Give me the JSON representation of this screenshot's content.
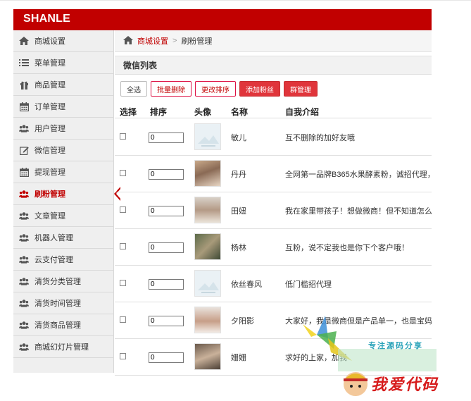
{
  "app": {
    "brand": "SHANLE",
    "colors": {
      "brand_red": "#c10000",
      "button_red": "#e0353b"
    }
  },
  "sidebar": {
    "items": [
      {
        "label": "商城设置",
        "icon": "home-icon"
      },
      {
        "label": "菜单管理",
        "icon": "list-icon"
      },
      {
        "label": "商品管理",
        "icon": "gift-icon"
      },
      {
        "label": "订单管理",
        "icon": "calendar-icon"
      },
      {
        "label": "用户管理",
        "icon": "users-icon"
      },
      {
        "label": "微信管理",
        "icon": "edit-icon"
      },
      {
        "label": "提现管理",
        "icon": "calendar-icon"
      },
      {
        "label": "刷粉管理",
        "icon": "users-icon",
        "active": true
      },
      {
        "label": "文章管理",
        "icon": "users-icon"
      },
      {
        "label": "机器人管理",
        "icon": "users-icon"
      },
      {
        "label": "云支付管理",
        "icon": "users-icon"
      },
      {
        "label": "清货分类管理",
        "icon": "users-icon"
      },
      {
        "label": "清货时间管理",
        "icon": "users-icon"
      },
      {
        "label": "清货商品管理",
        "icon": "users-icon"
      },
      {
        "label": "商城幻灯片管理",
        "icon": "users-icon"
      }
    ]
  },
  "breadcrumb": {
    "parent": "商城设置",
    "separator": ">",
    "current": "刷粉管理"
  },
  "panel": {
    "title": "微信列表"
  },
  "toolbar": {
    "select_all": "全选",
    "batch_delete": "批量删除",
    "change_order": "更改排序",
    "add_fans": "添加粉丝",
    "group_manage": "群管理"
  },
  "table": {
    "headers": {
      "select": "选择",
      "order": "排序",
      "avatar": "头像",
      "name": "名称",
      "intro": "自我介绍"
    },
    "rows": [
      {
        "order": "0",
        "avatar": "placeholder",
        "name": "敏儿",
        "intro": "互不删除的加好友哦"
      },
      {
        "order": "0",
        "avatar": "photo",
        "name": "丹丹",
        "intro": "全网第一品牌B365水果酵素粉，诚招代理，"
      },
      {
        "order": "0",
        "avatar": "photo",
        "name": "田妞",
        "intro": "我在家里带孩子！想做微商！但不知道怎么"
      },
      {
        "order": "0",
        "avatar": "photo",
        "name": "杨林",
        "intro": "互粉，说不定我也是你下个客户哦！"
      },
      {
        "order": "0",
        "avatar": "placeholder",
        "name": "依丝春风",
        "intro": "低门槛招代理"
      },
      {
        "order": "0",
        "avatar": "photo",
        "name": "夕阳影",
        "intro": "大家好，我是微商但是产品单一，也是宝妈"
      },
      {
        "order": "0",
        "avatar": "photo",
        "name": "姗姗",
        "intro": "求好的上家，加我"
      }
    ]
  },
  "watermark": {
    "line1": "专注源码分享",
    "line2": "我爱代码"
  }
}
